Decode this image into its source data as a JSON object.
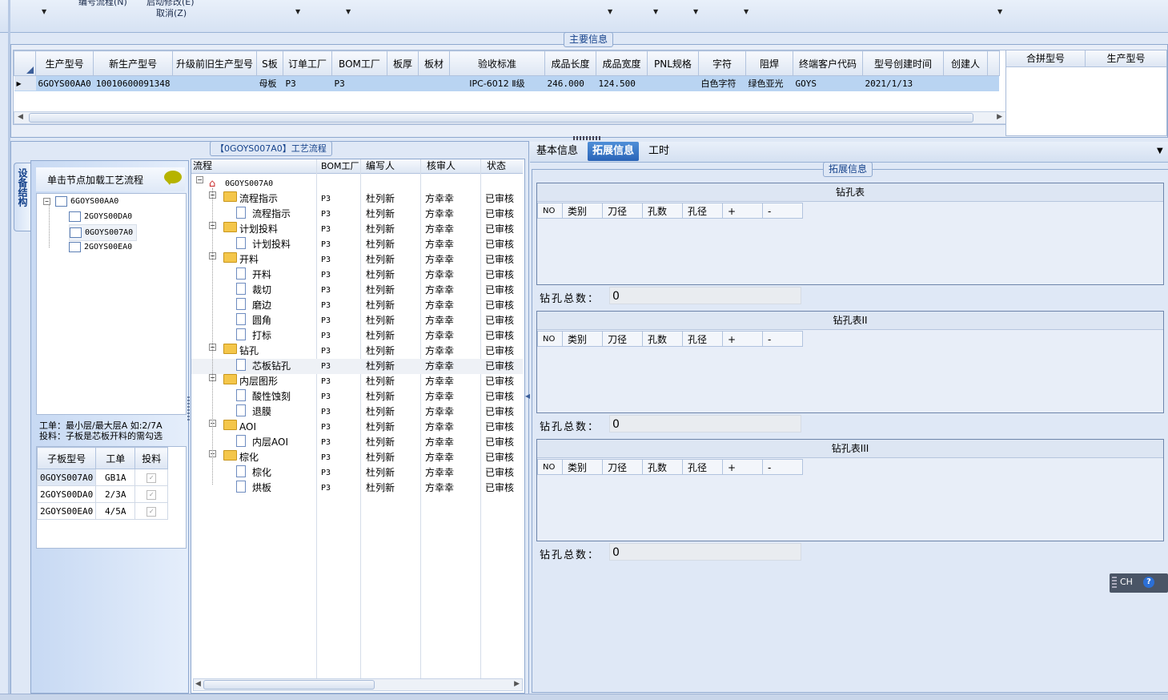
{
  "toolbar": {
    "item1": "编号流程(N)",
    "item2": "启动修改(E)",
    "cancel": "取消(Z)"
  },
  "main_info": {
    "title": "主要信息",
    "columns": [
      "生产型号",
      "新生产型号",
      "升级前旧生产型号",
      "S板",
      "订单工厂",
      "BOM工厂",
      "板厚",
      "板材",
      "验收标准",
      "成品长度",
      "成品宽度",
      "PNL规格",
      "字符",
      "阻焊",
      "终端客户代码",
      "型号创建时间",
      "创建人"
    ],
    "row": {
      "prod_no": "6GOYS00AA0",
      "new_prod_no": "10010600091348",
      "old_prod_no": "",
      "s_board": "母板",
      "order_factory": "P3",
      "bom_factory": "P3",
      "thickness": "",
      "material": "",
      "standard": "IPC-6012 Ⅱ级",
      "length": "246.000",
      "width": "124.500",
      "pnl": "",
      "char": "白色字符",
      "solder": "绿色亚光",
      "customer": "GOYS",
      "created": "2021/1/13",
      "creator": ""
    },
    "merge_columns": [
      "合拼型号",
      "生产型号"
    ]
  },
  "side_tab": "设备结构",
  "left": {
    "hint": "单击节点加载工艺流程",
    "tree": [
      "6GOYS00AA0",
      "2GOYS00DA0",
      "0GOYS007A0",
      "2GOYS00EA0"
    ],
    "note1": "工单：最小层/最大层A 如:2/7A",
    "note2": "投料：子板是芯板开料的需勾选",
    "sub_columns": [
      "子板型号",
      "工单",
      "投料"
    ],
    "sub_rows": [
      {
        "model": "0GOYS007A0",
        "order": "GB1A",
        "check": "✓"
      },
      {
        "model": "2GOYS00DA0",
        "order": "2/3A",
        "check": "✓"
      },
      {
        "model": "2GOYS00EA0",
        "order": "4/5A",
        "check": "✓"
      }
    ]
  },
  "process": {
    "title": "【0GOYS007A0】工艺流程",
    "columns": [
      "流程",
      "BOM工厂",
      "编写人",
      "核审人",
      "状态"
    ],
    "root": "0GOYS007A0",
    "rows": [
      {
        "name": "流程指示",
        "level": 1,
        "folder": true,
        "bom": "P3",
        "writer": "杜列新",
        "reviewer": "方幸幸",
        "status": "已审核"
      },
      {
        "name": "流程指示",
        "level": 2,
        "folder": false,
        "bom": "P3",
        "writer": "杜列新",
        "reviewer": "方幸幸",
        "status": "已审核"
      },
      {
        "name": "计划投料",
        "level": 1,
        "folder": true,
        "bom": "P3",
        "writer": "杜列新",
        "reviewer": "方幸幸",
        "status": "已审核"
      },
      {
        "name": "计划投料",
        "level": 2,
        "folder": false,
        "bom": "P3",
        "writer": "杜列新",
        "reviewer": "方幸幸",
        "status": "已审核"
      },
      {
        "name": "开料",
        "level": 1,
        "folder": true,
        "bom": "P3",
        "writer": "杜列新",
        "reviewer": "方幸幸",
        "status": "已审核"
      },
      {
        "name": "开料",
        "level": 2,
        "folder": false,
        "bom": "P3",
        "writer": "杜列新",
        "reviewer": "方幸幸",
        "status": "已审核"
      },
      {
        "name": "裁切",
        "level": 2,
        "folder": false,
        "bom": "P3",
        "writer": "杜列新",
        "reviewer": "方幸幸",
        "status": "已审核"
      },
      {
        "name": "磨边",
        "level": 2,
        "folder": false,
        "bom": "P3",
        "writer": "杜列新",
        "reviewer": "方幸幸",
        "status": "已审核"
      },
      {
        "name": "圆角",
        "level": 2,
        "folder": false,
        "bom": "P3",
        "writer": "杜列新",
        "reviewer": "方幸幸",
        "status": "已审核"
      },
      {
        "name": "打标",
        "level": 2,
        "folder": false,
        "bom": "P3",
        "writer": "杜列新",
        "reviewer": "方幸幸",
        "status": "已审核"
      },
      {
        "name": "钻孔",
        "level": 1,
        "folder": true,
        "bom": "P3",
        "writer": "杜列新",
        "reviewer": "方幸幸",
        "status": "已审核"
      },
      {
        "name": "芯板钻孔",
        "level": 2,
        "folder": false,
        "bom": "P3",
        "writer": "杜列新",
        "reviewer": "方幸幸",
        "status": "已审核",
        "selected": true
      },
      {
        "name": "内层图形",
        "level": 1,
        "folder": true,
        "bom": "P3",
        "writer": "杜列新",
        "reviewer": "方幸幸",
        "status": "已审核"
      },
      {
        "name": "酸性蚀刻",
        "level": 2,
        "folder": false,
        "bom": "P3",
        "writer": "杜列新",
        "reviewer": "方幸幸",
        "status": "已审核"
      },
      {
        "name": "退膜",
        "level": 2,
        "folder": false,
        "bom": "P3",
        "writer": "杜列新",
        "reviewer": "方幸幸",
        "status": "已审核"
      },
      {
        "name": "AOI",
        "level": 1,
        "folder": true,
        "bom": "P3",
        "writer": "杜列新",
        "reviewer": "方幸幸",
        "status": "已审核"
      },
      {
        "name": "内层AOI",
        "level": 2,
        "folder": false,
        "bom": "P3",
        "writer": "杜列新",
        "reviewer": "方幸幸",
        "status": "已审核"
      },
      {
        "name": "棕化",
        "level": 1,
        "folder": true,
        "bom": "P3",
        "writer": "杜列新",
        "reviewer": "方幸幸",
        "status": "已审核"
      },
      {
        "name": "棕化",
        "level": 2,
        "folder": false,
        "bom": "P3",
        "writer": "杜列新",
        "reviewer": "方幸幸",
        "status": "已审核"
      },
      {
        "name": "烘板",
        "level": 2,
        "folder": false,
        "bom": "P3",
        "writer": "杜列新",
        "reviewer": "方幸幸",
        "status": "已审核"
      }
    ]
  },
  "right": {
    "tabs": [
      "基本信息",
      "拓展信息",
      "工时"
    ],
    "active_tab": 1,
    "group_title": "拓展信息",
    "drill_columns": [
      "NO",
      "类别",
      "刀径",
      "孔数",
      "孔径",
      "+",
      "-"
    ],
    "tables": [
      {
        "title": "钻孔表",
        "total_label": "钻孔总数：",
        "total": "0"
      },
      {
        "title": "钻孔表II",
        "total_label": "钻孔总数：",
        "total": "0"
      },
      {
        "title": "钻孔表III",
        "total_label": "钻孔总数：",
        "total": "0"
      }
    ]
  },
  "ime": {
    "label": "CH",
    "help": "?"
  }
}
